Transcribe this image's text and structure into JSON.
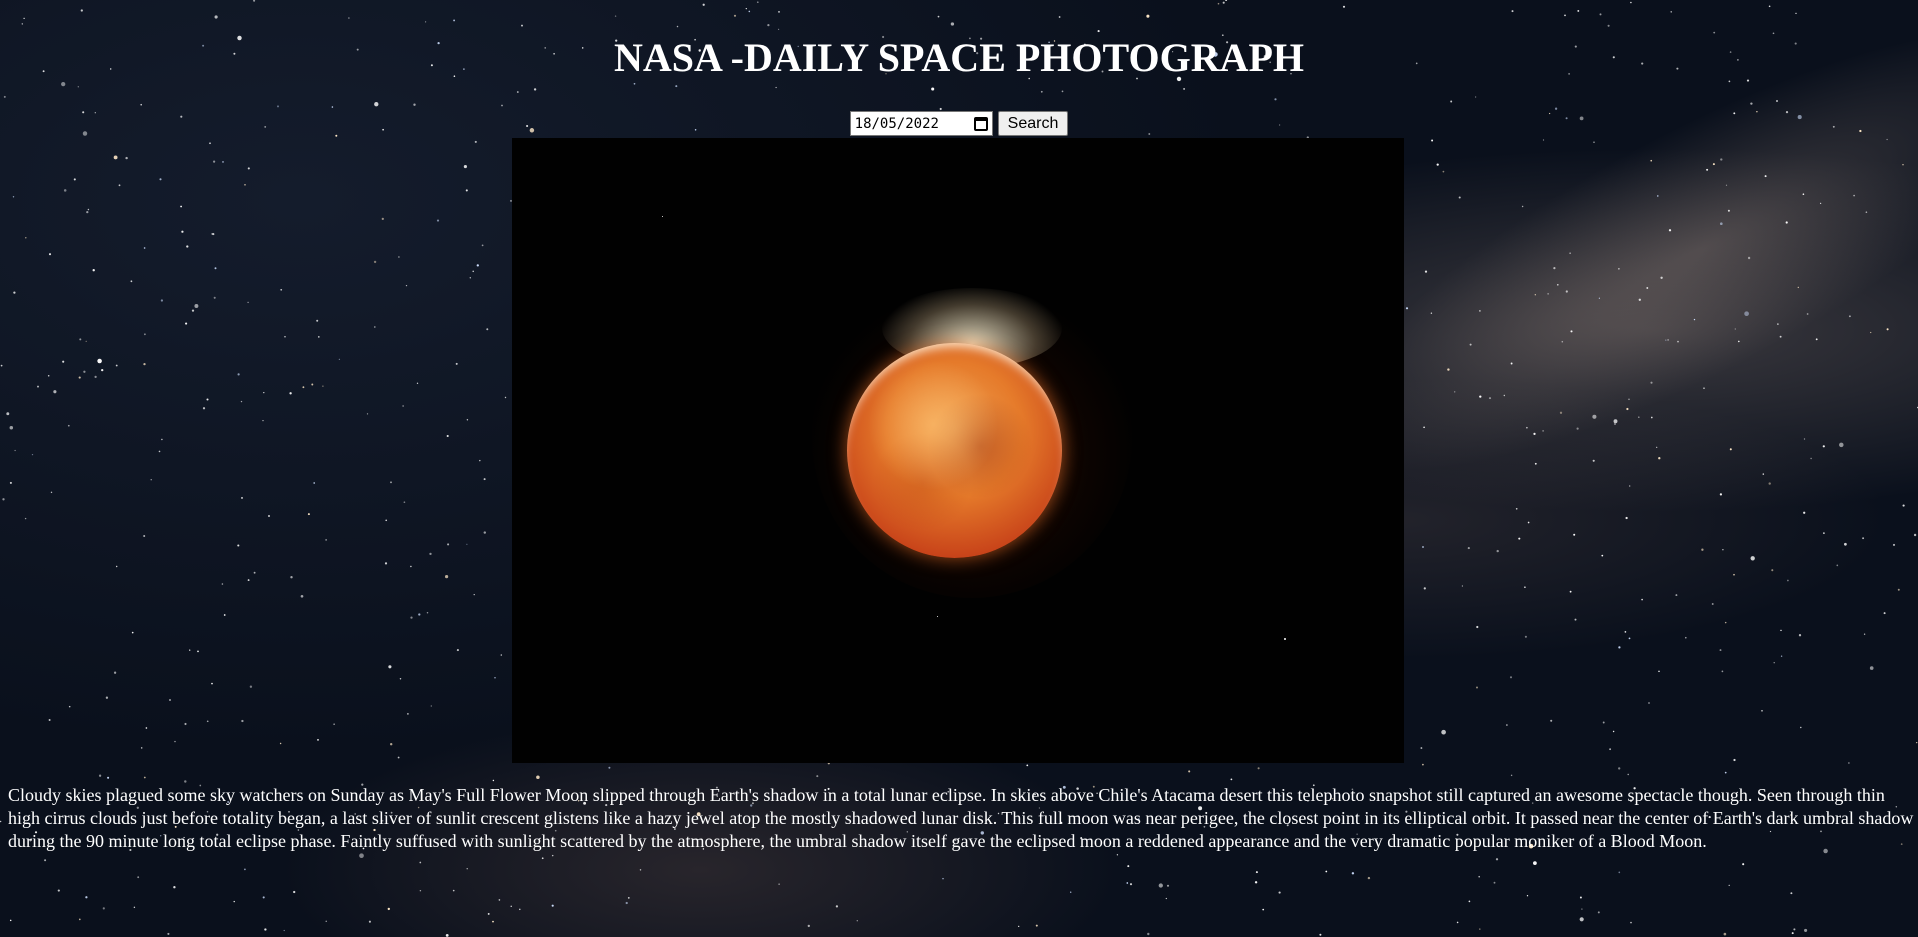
{
  "page": {
    "title": "NASA -DAILY SPACE PHOTOGRAPH"
  },
  "search": {
    "date_value": "18/05/2022",
    "button_label": "Search"
  },
  "photo": {
    "subject": "total lunar eclipse - Blood Moon"
  },
  "explanation": "Cloudy skies plagued some sky watchers on Sunday as May's Full Flower Moon slipped through Earth's shadow in a total lunar eclipse. In skies above Chile's Atacama desert this telephoto snapshot still captured an awesome spectacle though. Seen through thin high cirrus clouds just before totality began, a last sliver of sunlit crescent glistens like a hazy jewel atop the mostly shadowed lunar disk. This full moon was near perigee, the closest point in its elliptical orbit. It passed near the center of Earth's dark umbral shadow during the 90 minute long total eclipse phase. Faintly suffused with sunlight scattered by the atmosphere, the umbral shadow itself gave the eclipsed moon a reddened appearance and the very dramatic popular moniker of a Blood Moon.",
  "colors": {
    "text": "#ffffff",
    "sky_background": "#0d1422",
    "photo_background": "#010101",
    "moon": "#e57a2a"
  },
  "icons": {
    "date_picker": "calendar-icon"
  }
}
